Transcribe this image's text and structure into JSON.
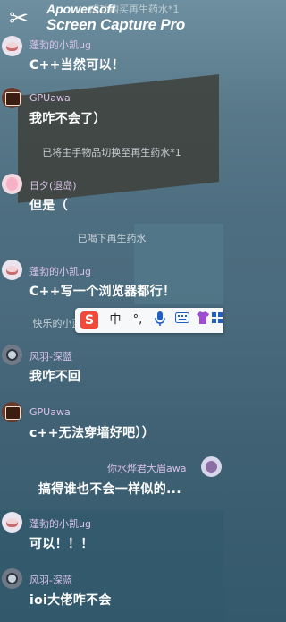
{
  "watermark": {
    "logo_icon": "scissors-icon",
    "line1": "Apowersoft",
    "line2": "Screen Capture Pro",
    "faint": "成功购买再生药水*1"
  },
  "messages": [
    {
      "name": "蓬勃的小凯ug",
      "text": "C++当然可以！",
      "avatar": "deer-avatar"
    },
    {
      "name": "GPUawa",
      "text": "我咋不会了）",
      "avatar": "gpu-avatar"
    },
    {
      "name": "日夕(退岛)",
      "text": "但是（",
      "avatar": "ri-avatar"
    },
    {
      "name": "蓬勃的小凯ug",
      "text": "C++写一个浏览器都行！",
      "avatar": "deer-avatar"
    },
    {
      "name": "风羽-深蓝",
      "text": "我咋不回",
      "avatar": "feng-avatar"
    },
    {
      "name": "GPUawa",
      "text": "c++无法穿墙好吧））",
      "avatar": "gpu-avatar"
    },
    {
      "name": "你水烨君大眉awa",
      "text": "搞得谁也不会一样似的...",
      "avatar": "shui-avatar"
    },
    {
      "name": "蓬勃的小凯ug",
      "text": "可以！！！",
      "avatar": "deer-avatar"
    },
    {
      "name": "风羽-深蓝",
      "text": "ioi大佬咋不会",
      "avatar": "feng-avatar"
    }
  ],
  "system": [
    "已将主手物品切换至再生药水*1",
    "已喝下再生药水",
    "快乐的小蓝bx 离开了地图"
  ],
  "ime": {
    "logo": "S",
    "items": [
      "中",
      "°,",
      "mic-icon",
      "keyboard-icon",
      "shirt-icon",
      "grid-icon"
    ],
    "accent": "#f04b3a"
  }
}
